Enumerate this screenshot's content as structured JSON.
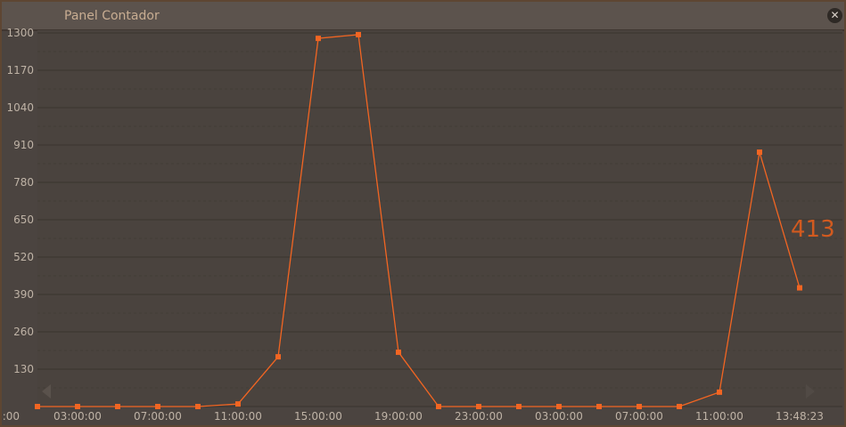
{
  "window": {
    "title": "Panel Contador",
    "close_icon": "close-icon"
  },
  "chart_data": {
    "type": "line",
    "title": "Panel Contador",
    "xlabel": "",
    "ylabel": "",
    "ylim": [
      0,
      1300
    ],
    "y_ticks": [
      "130",
      "260",
      "390",
      "520",
      "650",
      "780",
      "910",
      "1040",
      "1170",
      "1300"
    ],
    "x_tick_labels": [
      ":00",
      "03:00:00",
      "07:00:00",
      "11:00:00",
      "15:00:00",
      "19:00:00",
      "23:00:00",
      "03:00:00",
      "07:00:00",
      "11:00:00",
      "13:48:23"
    ],
    "grid": true,
    "series": [
      {
        "name": "Contador",
        "color": "#f26522",
        "values": [
          0,
          0,
          0,
          0,
          0,
          9,
          173,
          1281,
          1294,
          189,
          0,
          0,
          0,
          0,
          0,
          0,
          0,
          50,
          885,
          413
        ]
      }
    ],
    "last_value_label": "413"
  }
}
